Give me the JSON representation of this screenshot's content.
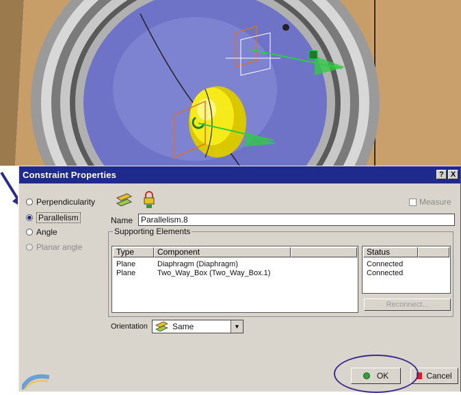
{
  "dialog": {
    "title": "Constraint Properties",
    "help_label": "?",
    "close_label": "X"
  },
  "constraint_types": [
    {
      "label": "Perpendicularity",
      "selected": false,
      "enabled": true
    },
    {
      "label": "Parallelism",
      "selected": true,
      "enabled": true
    },
    {
      "label": "Angle",
      "selected": false,
      "enabled": true
    },
    {
      "label": "Planar angle",
      "selected": false,
      "enabled": false
    }
  ],
  "measure": {
    "label": "Measure",
    "checked": false
  },
  "name": {
    "label": "Name",
    "value": "Parallelism.8"
  },
  "supporting": {
    "legend": "Supporting Elements",
    "columns": [
      "Type",
      "Component"
    ],
    "rows": [
      {
        "type": "Plane",
        "component": "Diaphragm (Diaphragm)"
      },
      {
        "type": "Plane",
        "component": "Two_Way_Box (Two_Way_Box.1)"
      }
    ],
    "status_header": "Status",
    "status_rows": [
      "Connected",
      "Connected"
    ],
    "reconnect_label": "Reconnect..."
  },
  "orientation": {
    "label": "Orientation",
    "value": "Same"
  },
  "buttons": {
    "ok": "OK",
    "cancel": "Cancel"
  },
  "colors": {
    "title_bar": "#1e2a8c",
    "dialog_bg": "#d9d4cc",
    "speaker_cone": "#6f73c8",
    "dust_cap": "#f2e400",
    "constraint_arrow": "#2ecc40"
  }
}
